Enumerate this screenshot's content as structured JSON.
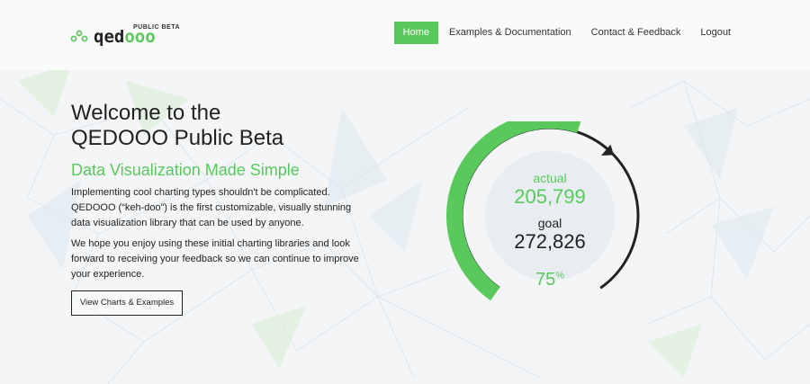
{
  "logo": {
    "wordmark_a": "qed",
    "wordmark_b": "ooo",
    "badge": "PUBLIC BETA"
  },
  "nav": [
    {
      "label": "Home",
      "active": true
    },
    {
      "label": "Examples & Documentation",
      "active": false
    },
    {
      "label": "Contact & Feedback",
      "active": false
    },
    {
      "label": "Logout",
      "active": false
    }
  ],
  "hero": {
    "title_line1": "Welcome to the",
    "title_line2": "QEDOOO Public Beta",
    "subtitle": "Data Visualization Made Simple",
    "para1": "Implementing cool charting types shouldn't be complicated. QEDOOO (“keh-doo”) is the first customizable, visually stunning data visualization library that can be used by anyone.",
    "para2": "We hope you enjoy using these initial charting libraries and look forward to receiving your feedback so we can continue to improve your experience.",
    "cta": "View Charts & Examples"
  },
  "gauge": {
    "actual_label": "actual",
    "actual_value": "205,799",
    "goal_label": "goal",
    "goal_value": "272,826",
    "percent": "75",
    "percent_sign": "%",
    "fraction": 0.75
  },
  "colors": {
    "accent": "#5ac95c",
    "text": "#222222",
    "arc": "#222222"
  }
}
